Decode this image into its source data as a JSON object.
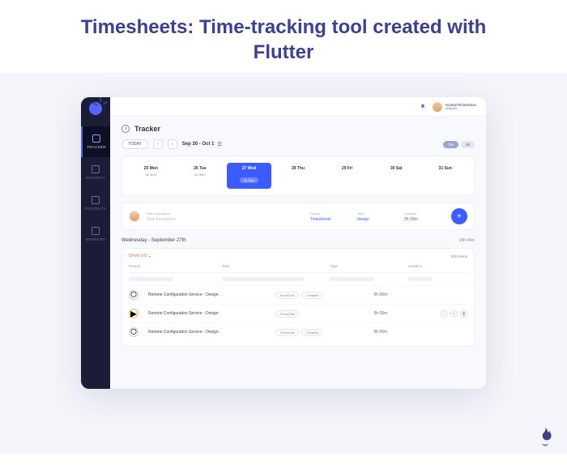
{
  "page_title": "Timesheets: Time-tracking tool created with Flutter",
  "colors": {
    "accent": "#3e3f8f",
    "primary": "#3d5cff",
    "orange": "#ff6a3d"
  },
  "sidebar": {
    "items": [
      {
        "icon": "clock-icon",
        "label": "TRACKER",
        "active": true
      },
      {
        "icon": "reports-icon",
        "label": "REPORTS",
        "active": false
      },
      {
        "icon": "projects-icon",
        "label": "PROJECTS",
        "active": false
      },
      {
        "icon": "members-icon",
        "label": "MEMBERS",
        "active": false
      }
    ]
  },
  "topbar": {
    "bell_icon": "bell-icon",
    "user_name": "Krystal Richardson",
    "user_org": "Miquido"
  },
  "tracker": {
    "title": "Tracker",
    "today_label": "TODAY",
    "range": "Sep 30 - Oct 1",
    "total_toggle": {
      "on": "ON",
      "value": "40"
    },
    "week": [
      {
        "label": "25 Mon",
        "hours": "8h 30m"
      },
      {
        "label": "26 Tue",
        "hours": "0h 00m"
      },
      {
        "label": "27 Wed",
        "hours": "0h 00m",
        "active": true
      },
      {
        "label": "28 Thu",
        "hours": ""
      },
      {
        "label": "29 Fri",
        "hours": ""
      },
      {
        "label": "30 Sat",
        "hours": ""
      },
      {
        "label": "31 Sun",
        "hours": ""
      }
    ],
    "new_task": {
      "desc_label": "Task Description",
      "desc_placeholder": "Task description",
      "project_label": "Project",
      "project_value": "Timesheets",
      "tags_label": "Tags",
      "tags_value": "design",
      "duration_label": "Duration",
      "duration_value": "0h 00m"
    },
    "day_header": "Wednesday - September 27th",
    "day_total": "18h 44m",
    "list": {
      "person": "Drive US",
      "edit_label": "Edit Items",
      "columns": [
        "Person",
        "Task",
        "Tags",
        "Duration"
      ],
      "rows": [
        {
          "icon": "clock",
          "name": "Remote Configuration Service - Design",
          "tags": [
            "Front-End",
            "Creative"
          ],
          "duration": "0h 00m"
        },
        {
          "icon": "play",
          "name": "Remote Configuration Service - Design",
          "tags": [
            "Front-End"
          ],
          "duration": "0h 00m"
        },
        {
          "icon": "clock",
          "name": "Remote Configuration Service - Design",
          "tags": [
            "Front-End",
            "Creative"
          ],
          "duration": "0h 00m"
        }
      ]
    }
  }
}
